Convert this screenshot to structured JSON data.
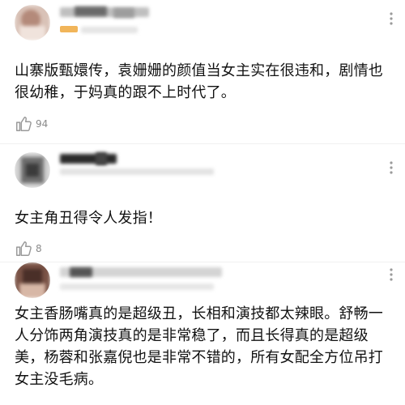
{
  "comments": [
    {
      "text": "山寨版甄嬛传，袁姗姗的颜值当女主实在很违和，剧情也很幼稚，于妈真的跟不上时代了。",
      "likes": "94",
      "avatar_colors": [
        "#c9a79a",
        "#e8d2c7",
        "#a4756a"
      ],
      "name_colors": [
        "#5a5a5a",
        "#c8c8c8",
        "#8d8d8d"
      ],
      "meta_colors": [
        "#f1b55a",
        "#e8e3dc",
        "#d9d9d9"
      ]
    },
    {
      "text": "女主角丑得令人发指！",
      "likes": "8",
      "avatar_colors": [
        "#6d6d6d",
        "#b3b3b3",
        "#3b3b3b"
      ],
      "name_colors": [
        "#2a2a2a",
        "#bdbdbd",
        "#777777"
      ],
      "meta_colors": [
        "#d8d8d8",
        "#ececec",
        "#d0d0d0"
      ]
    },
    {
      "text": "女主香肠嘴真的是超级丑，长相和演技都太辣眼。舒畅一人分饰两角演技真的是非常稳了，而且长得真的是超级美，杨蓉和张嘉倪也是非常不错的，所有女配全方位吊打女主没毛病。",
      "avatar_colors": [
        "#4a2f28",
        "#8a5a4c",
        "#d7b7a6"
      ],
      "name_colors": [
        "#4a4a4a",
        "#cfcfcf",
        "#9a9a9a"
      ],
      "meta_colors": [
        "#d7d7d7",
        "#efefef",
        "#cccccc"
      ]
    }
  ],
  "icons": {
    "like": "thumbs-up-icon",
    "more": "more-icon"
  }
}
